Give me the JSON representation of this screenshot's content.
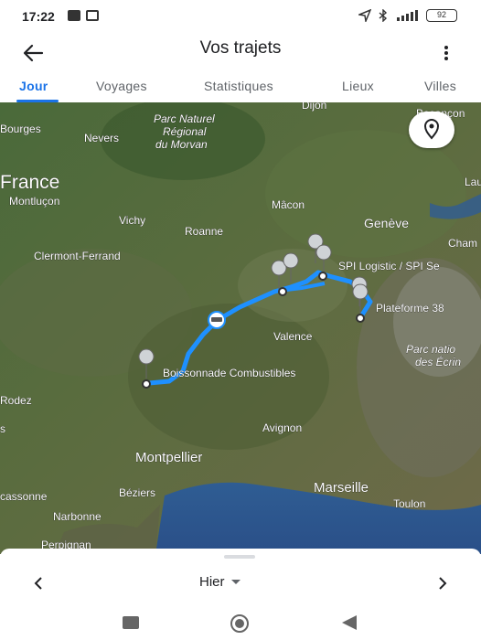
{
  "status": {
    "time": "17:22",
    "left_icons": [
      "linkedin-icon",
      "message-icon"
    ],
    "right_icons": [
      "location-arrow-icon",
      "bluetooth-icon",
      "signal-icon"
    ],
    "battery": "92"
  },
  "header": {
    "title": "Vos trajets",
    "back_icon": "arrow-left-icon",
    "more_icon": "more-vert-icon"
  },
  "tabs": [
    {
      "label": "Jour",
      "active": true
    },
    {
      "label": "Voyages",
      "active": false
    },
    {
      "label": "Statistiques",
      "active": false
    },
    {
      "label": "Lieux",
      "active": false
    },
    {
      "label": "Villes",
      "active": false
    }
  ],
  "colors": {
    "accent": "#1a73e8",
    "route": "#1e90ff",
    "pin": "#ffffff"
  },
  "map": {
    "labels": {
      "dijon": "Dijon",
      "besancon": "Besançon",
      "bourges": "Bourges",
      "nevers": "Nevers",
      "parc_morvan": [
        "Parc Naturel",
        "Régional",
        "du Morvan"
      ],
      "france": "France",
      "montlucon": "Montluçon",
      "vichy": "Vichy",
      "macon": "Mâcon",
      "geneve": "Genève",
      "roanne": "Roanne",
      "clermont": "Clermont-Ferrand",
      "cham": "Cham",
      "spi": "SPI Logistic / SPI Se",
      "plateforme": "Plateforme 38",
      "valence": "Valence",
      "parc_national": [
        "Parc natio",
        "des Écrin"
      ],
      "boissonnade": "Boissonnade Combustibles",
      "rodez": "Rodez",
      "avignon": "Avignon",
      "montpellier": "Montpellier",
      "marseille": "Marseille",
      "carcassonne": "cassonne",
      "beziers": "Béziers",
      "toulon": "Toulon",
      "narbonne": "Narbonne",
      "perpignan": "Perpignan",
      "lau": "Lau",
      "edge_s": "s"
    },
    "locate_icon": "place-icon"
  },
  "day_nav": {
    "label": "Hier",
    "prev_icon": "chevron-left-icon",
    "next_icon": "chevron-right-icon",
    "dropdown_icon": "caret-down-icon"
  },
  "system_nav": [
    "recent-apps-icon",
    "home-icon",
    "back-triangle-icon"
  ]
}
